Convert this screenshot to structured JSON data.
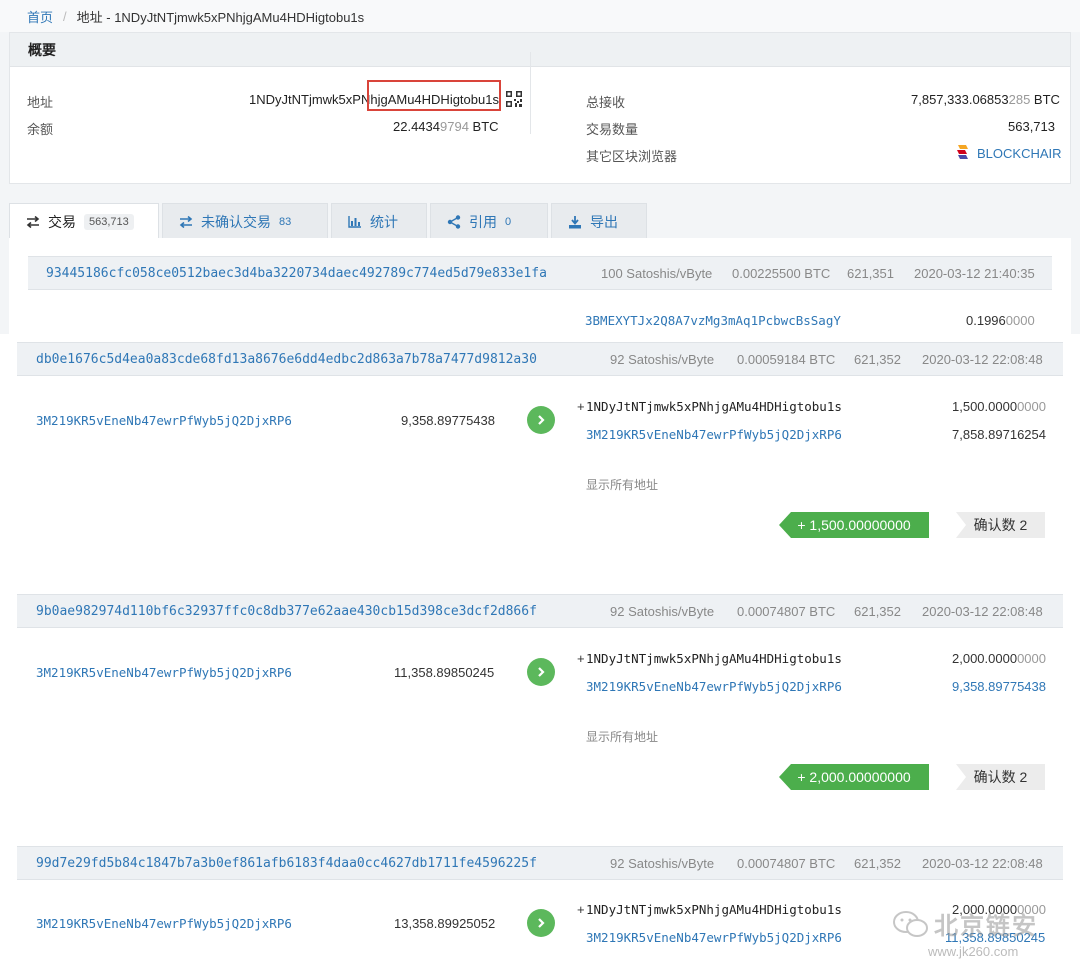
{
  "breadcrumb": {
    "home": "首页",
    "current": "地址 - 1NDyJtNTjmwk5xPNhjgAMu4HDHigtobu1s"
  },
  "overview": {
    "title": "概要",
    "address_label": "地址",
    "address_value": "1NDyJtNTjmwk5xPNhjgAMu4HDHigtobu1s",
    "balance_label": "余额",
    "balance_main": "22.4434",
    "balance_dim": "9794",
    "balance_unit": " BTC",
    "total_received_label": "总接收",
    "total_received_main": "7,857,333.06853",
    "total_received_dim": "285",
    "total_received_unit": " BTC",
    "tx_count_label": "交易数量",
    "tx_count_value": "563,713",
    "other_explorer_label": "其它区块浏览器",
    "other_explorer_link": "BLOCKCHAIR"
  },
  "tabs": [
    {
      "label": "交易",
      "count": "563,713",
      "icon": "exchange-icon"
    },
    {
      "label": "未确认交易",
      "count": "83",
      "icon": "exchange-icon"
    },
    {
      "label": "统计",
      "count": "",
      "icon": "bar-chart-icon"
    },
    {
      "label": "引用",
      "count": "0",
      "icon": "share-icon"
    },
    {
      "label": "导出",
      "count": "",
      "icon": "download-icon"
    }
  ],
  "tx0": {
    "hash": "93445186cfc058ce0512baec3d4ba3220734daec492789c774ed5d79e833e1fa",
    "fee_rate": "100 Satoshis/vByte",
    "fee": "0.00225500 BTC",
    "block": "621,351",
    "time": "2020-03-12 21:40:35",
    "out_addr": "3BMEXYTJx2Q8A7vzMg3mAq1PcbwcBsSagY",
    "out_amt_main": "0.1996",
    "out_amt_dim": "0000"
  },
  "tx1": {
    "hash": "db0e1676c5d4ea0a83cde68fd13a8676e6dd4edbc2d863a7b78a7477d9812a30",
    "fee_rate": "92 Satoshis/vByte",
    "fee": "0.00059184 BTC",
    "block": "621,352",
    "time": "2020-03-12 22:08:48",
    "in_addr": "3M219KR5vEneNb47ewrPfWyb5jQ2DjxRP6",
    "in_amt": "9,358.89775438",
    "out1_prefix": "+",
    "out1_addr": "1NDyJtNTjmwk5xPNhjgAMu4HDHigtobu1s",
    "out1_amt_main": "1,500.0000",
    "out1_amt_dim": "0000",
    "out2_addr": "3M219KR5vEneNb47ewrPfWyb5jQ2DjxRP6",
    "out2_amt_main": "7,858.89716254",
    "show_all": "显示所有地址",
    "amount": "+ 1,500.00000000",
    "confirm": "确认数 2"
  },
  "tx2": {
    "hash": "9b0ae982974d110bf6c32937ffc0c8db377e62aae430cb15d398ce3dcf2d866f",
    "fee_rate": "92 Satoshis/vByte",
    "fee": "0.00074807 BTC",
    "block": "621,352",
    "time": "2020-03-12 22:08:48",
    "in_addr": "3M219KR5vEneNb47ewrPfWyb5jQ2DjxRP6",
    "in_amt": "11,358.89850245",
    "out1_prefix": "+",
    "out1_addr": "1NDyJtNTjmwk5xPNhjgAMu4HDHigtobu1s",
    "out1_amt_main": "2,000.0000",
    "out1_amt_dim": "0000",
    "out2_addr": "3M219KR5vEneNb47ewrPfWyb5jQ2DjxRP6",
    "out2_amt_main": "9,358.89775438",
    "show_all": "显示所有地址",
    "amount": "+ 2,000.00000000",
    "confirm": "确认数 2"
  },
  "tx3": {
    "hash": "99d7e29fd5b84c1847b7a3b0ef861afb6183f4daa0cc4627db1711fe4596225f",
    "fee_rate": "92 Satoshis/vByte",
    "fee": "0.00074807 BTC",
    "block": "621,352",
    "time": "2020-03-12 22:08:48",
    "in_addr": "3M219KR5vEneNb47ewrPfWyb5jQ2DjxRP6",
    "in_amt": "13,358.89925052",
    "out1_prefix": "+",
    "out1_addr": "1NDyJtNTjmwk5xPNhjgAMu4HDHigtobu1s",
    "out1_amt_main": "2,000.0000",
    "out1_amt_dim": "0000",
    "out2_addr": "3M219KR5vEneNb47ewrPfWyb5jQ2DjxRP6",
    "out2_amt_main": "11,358.89850245"
  },
  "watermark": {
    "brand": "北京链安",
    "site": "www.jk260.com"
  },
  "colors": {
    "link": "#2f77b6",
    "green": "#4cae4c",
    "highlight_box": "#d9443a"
  }
}
